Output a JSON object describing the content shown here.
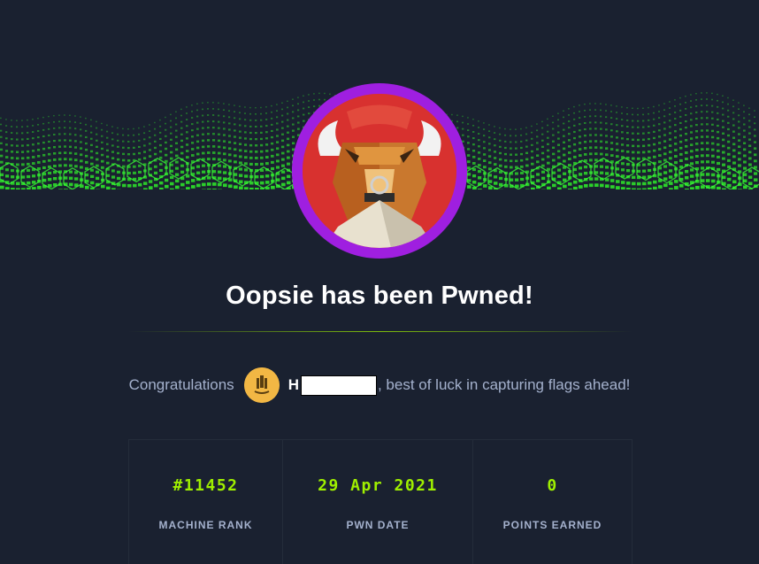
{
  "header": {
    "title": "Oopsie has been Pwned!"
  },
  "congrats": {
    "prefix": "Congratulations",
    "username_visible": "H",
    "suffix": ", best of luck in capturing flags ahead!"
  },
  "stats": [
    {
      "value": "#11452",
      "label": "MACHINE RANK"
    },
    {
      "value": "29 Apr 2021",
      "label": "PWN DATE"
    },
    {
      "value": "0",
      "label": "POINTS EARNED"
    }
  ],
  "colors": {
    "background": "#1a2130",
    "accent_green": "#9fef00",
    "avatar_ring": "#9f1fe0",
    "avatar_bg": "#d8312f",
    "user_avatar_bg": "#f2b744"
  },
  "icons": {
    "machine_avatar": "bull-mascot-icon",
    "user_avatar": "user-avatar-icon"
  }
}
